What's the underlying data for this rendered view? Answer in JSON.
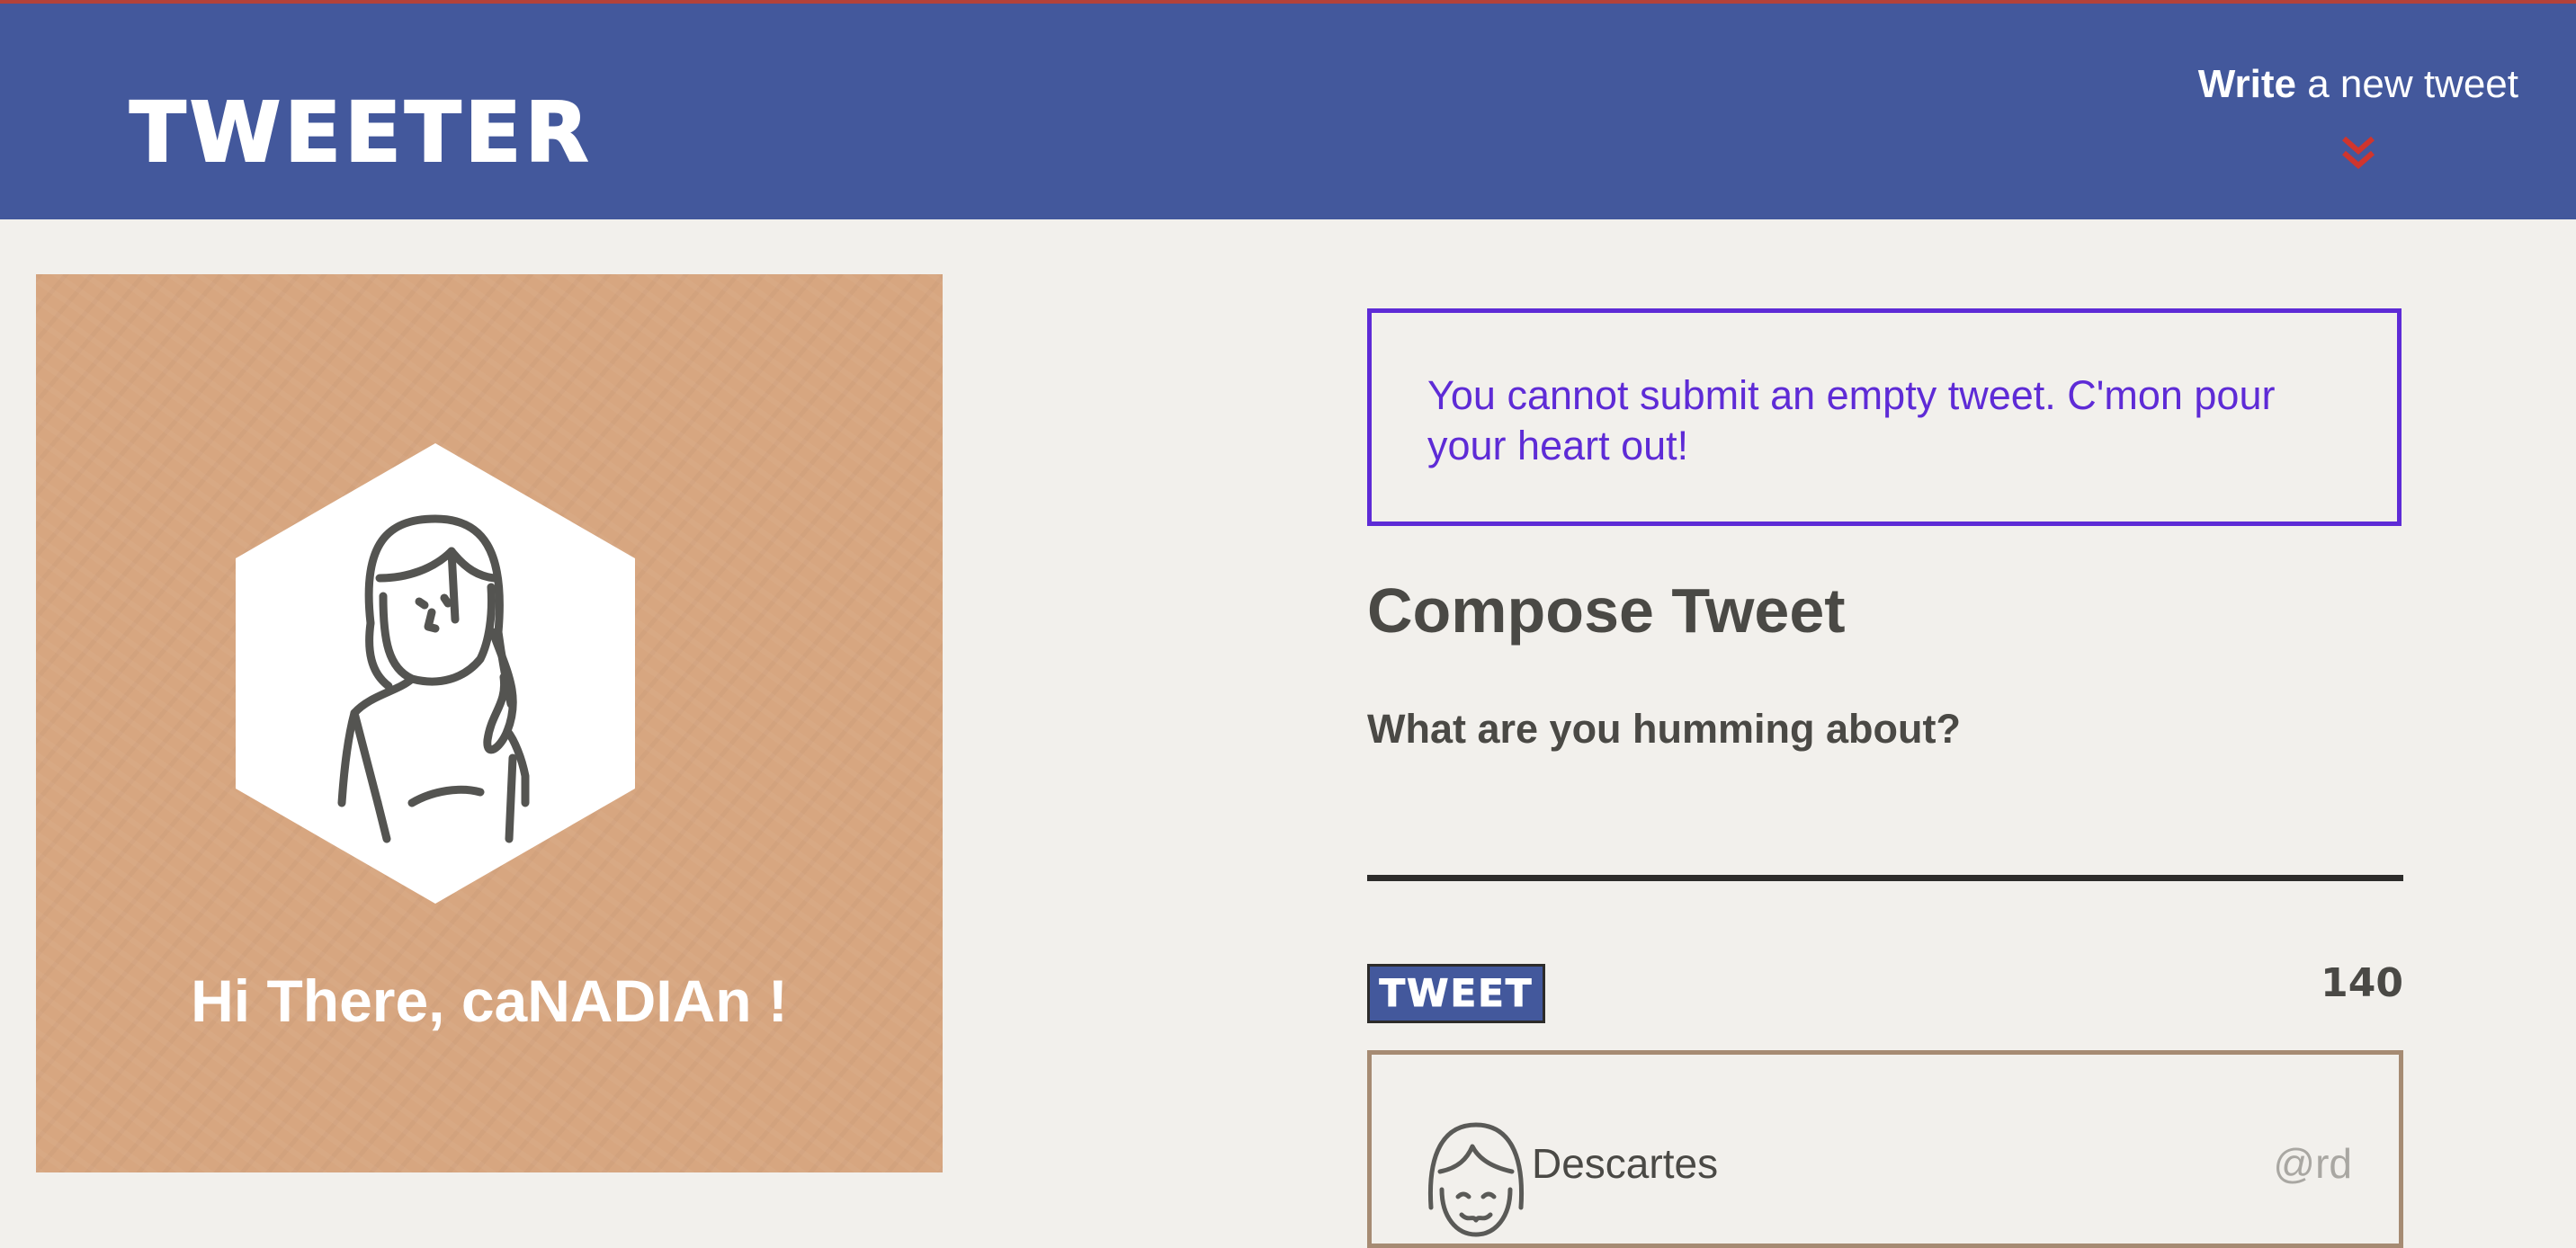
{
  "header": {
    "brand": "TWEETER",
    "write_bold": "Write",
    "write_rest": " a new tweet"
  },
  "profile": {
    "greeting": "Hi There, caNADIAn !"
  },
  "compose": {
    "error": "You cannot submit an empty tweet. C'mon pour your heart out!",
    "title": "Compose Tweet",
    "label": "What are you humming about?",
    "input_value": "",
    "button_label": "TWEET",
    "counter": "140"
  },
  "tweets": [
    {
      "name": "Descartes",
      "handle": "@rd"
    }
  ],
  "icons": {
    "chevron": "double-chevron-down-icon",
    "profile_avatar": "woman-avatar-icon",
    "tweet_avatar": "user-avatar-icon"
  },
  "colors": {
    "nav": "#43589c",
    "accent_red": "#d0352d",
    "profile_bg": "#d7a680",
    "error": "#5e2bd6",
    "text": "#4a4945",
    "page_bg": "#f2f0ec"
  }
}
